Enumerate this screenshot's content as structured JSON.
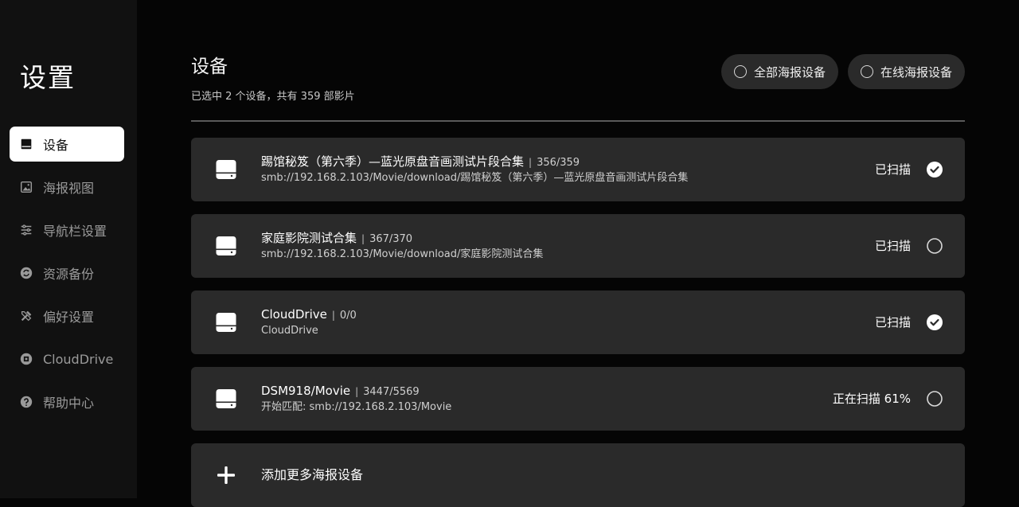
{
  "sidebar": {
    "title": "设置",
    "items": [
      {
        "label": "设备",
        "icon": "drive-icon",
        "active": true
      },
      {
        "label": "海报视图",
        "icon": "image-icon",
        "active": false
      },
      {
        "label": "导航栏设置",
        "icon": "sliders-icon",
        "active": false
      },
      {
        "label": "资源备份",
        "icon": "sync-icon",
        "active": false
      },
      {
        "label": "偏好设置",
        "icon": "tools-icon",
        "active": false
      },
      {
        "label": "CloudDrive",
        "icon": "clouddrive-icon",
        "active": false
      },
      {
        "label": "帮助中心",
        "icon": "help-icon",
        "active": false
      }
    ]
  },
  "main": {
    "title": "设备",
    "subtitle": "已选中 2 个设备，共有 359 部影片",
    "filters": [
      {
        "label": "全部海报设备",
        "selected": false
      },
      {
        "label": "在线海报设备",
        "selected": false
      }
    ],
    "devices": [
      {
        "name": "踢馆秘笈（第六季）—蓝光原盘音画测试片段合集",
        "count": "356/359",
        "path": "smb://192.168.2.103/Movie/download/踢馆秘笈（第六季）—蓝光原盘音画测试片段合集",
        "status": "已扫描",
        "checked": true
      },
      {
        "name": "家庭影院测试合集",
        "count": "367/370",
        "path": "smb://192.168.2.103/Movie/download/家庭影院测试合集",
        "status": "已扫描",
        "checked": false
      },
      {
        "name": "CloudDrive",
        "count": "0/0",
        "path": "CloudDrive",
        "status": "已扫描",
        "checked": true
      },
      {
        "name": "DSM918/Movie",
        "count": "3447/5569",
        "path": "开始匹配: smb://192.168.2.103/Movie",
        "status": "正在扫描 61%",
        "checked": false
      }
    ],
    "add_label": "添加更多海报设备"
  },
  "colors": {
    "background": "#050505",
    "sidebar": "#111111",
    "card": "#2a2a2a",
    "active_nav": "#ffffff"
  }
}
